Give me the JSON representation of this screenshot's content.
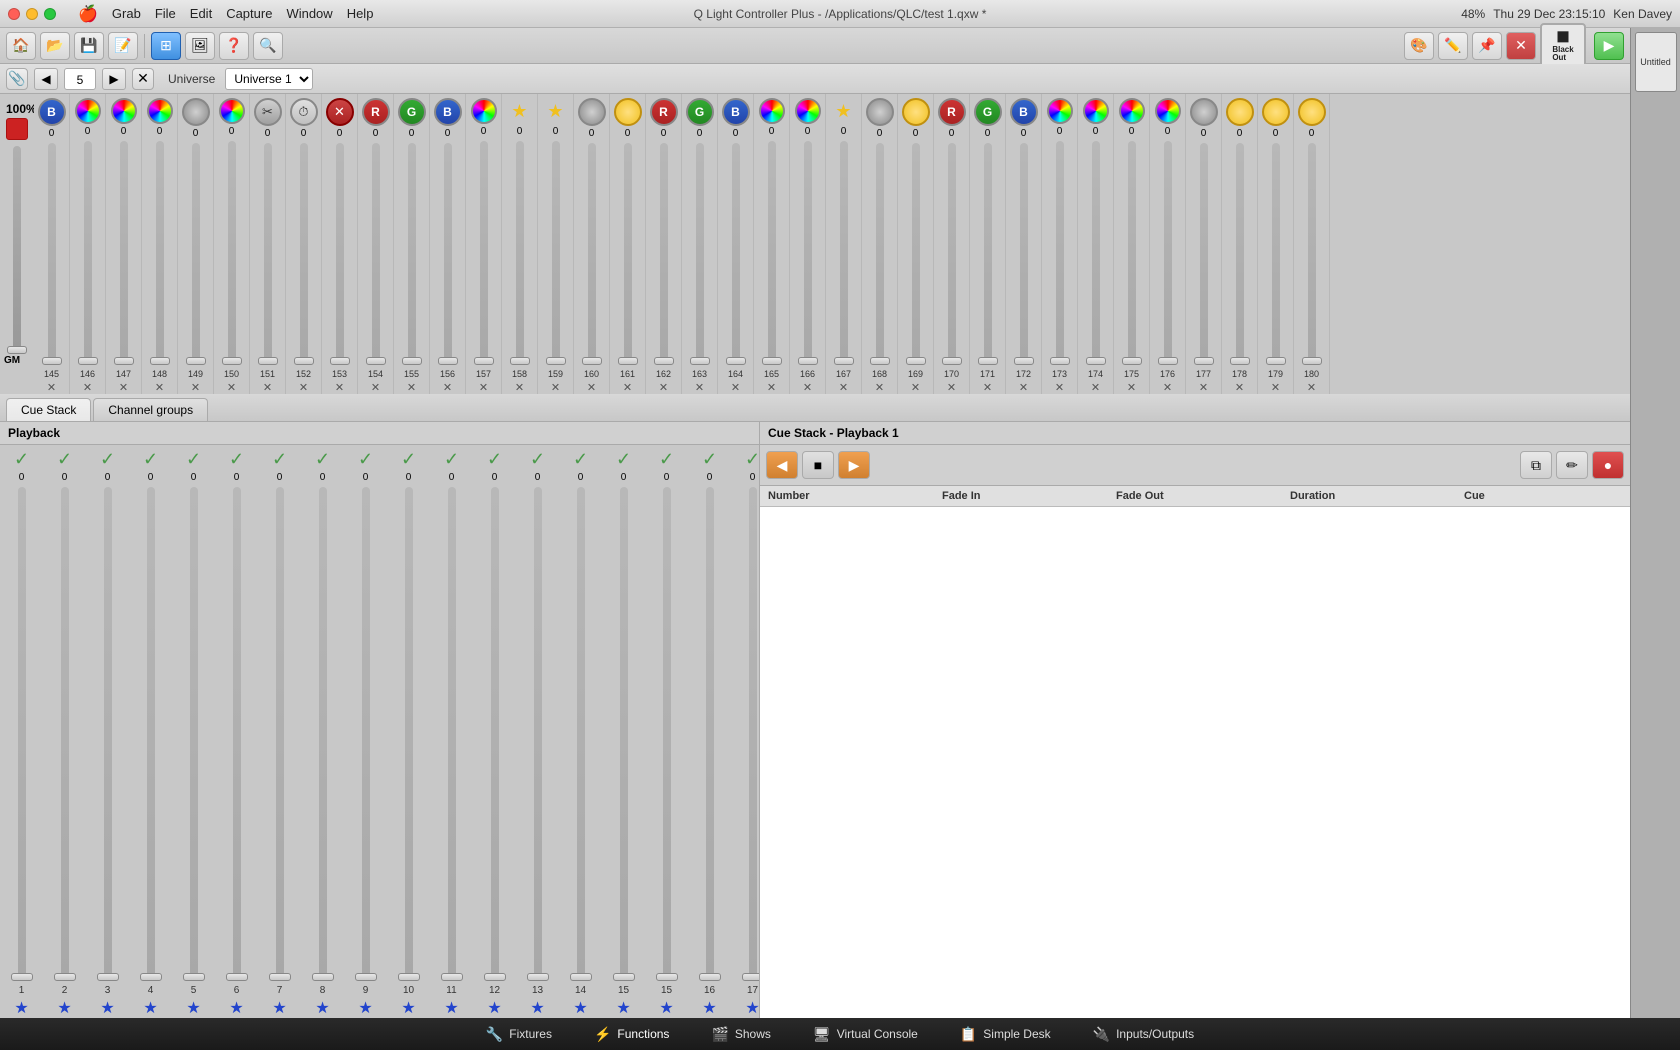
{
  "titlebar": {
    "title": "Q Light Controller Plus - /Applications/QLC/test 1.qxw *",
    "time": "Thu 29 Dec  23:15:10",
    "user": "Ken Davey",
    "battery": "48%",
    "apple_menu": "🍎",
    "menus": [
      "Grab",
      "File",
      "Edit",
      "Capture",
      "Window",
      "Help"
    ]
  },
  "toolbar": {
    "blackout_label": "Black\nOut",
    "play_icon": "▶"
  },
  "universe_bar": {
    "label": "Universe",
    "universe_name": "Universe 1",
    "nav_prev": "◀",
    "nav_next": "▶",
    "num": "5"
  },
  "dmx": {
    "percent": "100%",
    "gm_label": "GM",
    "channels": [
      {
        "num": "145",
        "type": "blue",
        "label": "B",
        "value": "0"
      },
      {
        "num": "146",
        "type": "colorwheel",
        "label": "",
        "value": "0"
      },
      {
        "num": "147",
        "type": "colorwheel",
        "label": "",
        "value": "0"
      },
      {
        "num": "148",
        "type": "colorwheel",
        "label": "",
        "value": "0"
      },
      {
        "num": "149",
        "type": "gray",
        "label": "",
        "value": "0"
      },
      {
        "num": "150",
        "type": "colorwheel",
        "label": "",
        "value": "0"
      },
      {
        "num": "151",
        "type": "tools",
        "label": "",
        "value": "0"
      },
      {
        "num": "152",
        "type": "clock",
        "label": "",
        "value": "0"
      },
      {
        "num": "153",
        "type": "cross",
        "label": "",
        "value": "0"
      },
      {
        "num": "154",
        "type": "red",
        "label": "R",
        "value": "0"
      },
      {
        "num": "155",
        "type": "green",
        "label": "G",
        "value": "0"
      },
      {
        "num": "156",
        "type": "blue",
        "label": "B",
        "value": "0"
      },
      {
        "num": "157",
        "type": "colorwheel",
        "label": "",
        "value": "0"
      },
      {
        "num": "158",
        "type": "star",
        "label": "★",
        "value": "0"
      },
      {
        "num": "159",
        "type": "star",
        "label": "★",
        "value": "0"
      },
      {
        "num": "160",
        "type": "gray",
        "label": "",
        "value": "0"
      },
      {
        "num": "161",
        "type": "light",
        "label": "",
        "value": "0"
      },
      {
        "num": "162",
        "type": "red",
        "label": "R",
        "value": "0"
      },
      {
        "num": "163",
        "type": "green",
        "label": "G",
        "value": "0"
      },
      {
        "num": "164",
        "type": "blue",
        "label": "B",
        "value": "0"
      },
      {
        "num": "165",
        "type": "colorwheel",
        "label": "",
        "value": "0"
      },
      {
        "num": "166",
        "type": "colorwheel",
        "label": "",
        "value": "0"
      },
      {
        "num": "167",
        "type": "star",
        "label": "★",
        "value": "0"
      },
      {
        "num": "168",
        "type": "gray",
        "label": "",
        "value": "0"
      },
      {
        "num": "169",
        "type": "light",
        "label": "",
        "value": "0"
      },
      {
        "num": "170",
        "type": "red",
        "label": "R",
        "value": "0"
      },
      {
        "num": "171",
        "type": "green",
        "label": "G",
        "value": "0"
      },
      {
        "num": "172",
        "type": "blue",
        "label": "B",
        "value": "0"
      },
      {
        "num": "173",
        "type": "colorwheel",
        "label": "",
        "value": "0"
      },
      {
        "num": "174",
        "type": "colorwheel",
        "label": "",
        "value": "0"
      },
      {
        "num": "175",
        "type": "colorwheel",
        "label": "",
        "value": "0"
      },
      {
        "num": "176",
        "type": "colorwheel",
        "label": "",
        "value": "0"
      },
      {
        "num": "177",
        "type": "gray",
        "label": "",
        "value": "0"
      },
      {
        "num": "178",
        "type": "light",
        "label": "",
        "value": "0"
      },
      {
        "num": "179",
        "type": "light",
        "label": "",
        "value": "0"
      },
      {
        "num": "180",
        "type": "light",
        "label": "",
        "value": "0"
      }
    ]
  },
  "tabs": {
    "items": [
      {
        "label": "Cue Stack",
        "active": true
      },
      {
        "label": "Channel groups",
        "active": false
      }
    ]
  },
  "playback": {
    "title": "Playback",
    "channels": [
      {
        "num": "1",
        "value": "0"
      },
      {
        "num": "2",
        "value": "0"
      },
      {
        "num": "3",
        "value": "0"
      },
      {
        "num": "4",
        "value": "0"
      },
      {
        "num": "5",
        "value": "0"
      },
      {
        "num": "6",
        "value": "0"
      },
      {
        "num": "7",
        "value": "0"
      },
      {
        "num": "8",
        "value": "0"
      },
      {
        "num": "9",
        "value": "0"
      },
      {
        "num": "10",
        "value": "0"
      },
      {
        "num": "11",
        "value": "0"
      },
      {
        "num": "12",
        "value": "0"
      },
      {
        "num": "13",
        "value": "0"
      },
      {
        "num": "14",
        "value": "0"
      },
      {
        "num": "15",
        "value": "0"
      },
      {
        "num": "15",
        "value": "0"
      },
      {
        "num": "16",
        "value": "0"
      },
      {
        "num": "17",
        "value": "0"
      }
    ]
  },
  "cue_stack": {
    "title": "Cue Stack - Playback 1",
    "nav_back": "◀",
    "nav_stop": "■",
    "nav_forward": "▶",
    "copy_icon": "⧉",
    "edit_icon": "✏",
    "delete_icon": "⏺",
    "columns": [
      "Number",
      "Fade In",
      "Fade Out",
      "Duration",
      "Cue"
    ]
  },
  "bottom_nav": {
    "items": [
      {
        "label": "Fixtures",
        "icon": "🔧",
        "active": false
      },
      {
        "label": "Functions",
        "icon": "⚡",
        "active": true
      },
      {
        "label": "Shows",
        "icon": "🎬",
        "active": false
      },
      {
        "label": "Virtual Console",
        "icon": "🖥",
        "active": false
      },
      {
        "label": "Simple Desk",
        "icon": "📋",
        "active": false
      },
      {
        "label": "Inputs/Outputs",
        "icon": "🔌",
        "active": false
      }
    ]
  },
  "sidebar": {
    "label": "Untitled"
  }
}
